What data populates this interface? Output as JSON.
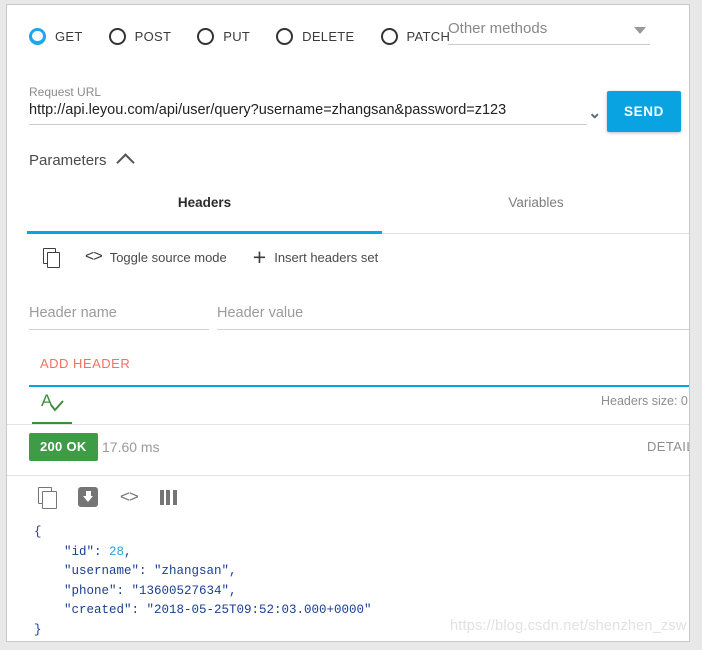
{
  "methods": {
    "options": [
      {
        "label": "GET",
        "selected": true
      },
      {
        "label": "POST",
        "selected": false
      },
      {
        "label": "PUT",
        "selected": false
      },
      {
        "label": "DELETE",
        "selected": false
      },
      {
        "label": "PATCH",
        "selected": false
      }
    ],
    "other_methods_label": "Other methods",
    "accent_color": "#1ca8e8"
  },
  "request": {
    "url_label": "Request URL",
    "url_value": "http://api.leyou.com/api/user/query?username=zhangsan&password=z123",
    "url_caret_icon": "chevron-down-icon",
    "send_label": "SEND",
    "send_color": "#08a3e0"
  },
  "parameters": {
    "title": "Parameters",
    "collapse_icon": "chevron-up-icon",
    "tabs": [
      {
        "label": "Headers",
        "active": true
      },
      {
        "label": "Variables",
        "active": false
      }
    ],
    "tab_underline_color": "#06a5de"
  },
  "headers_toolbar": {
    "copy_icon": "copy-icon",
    "source_icon": "code-brackets-icon",
    "source_label": "Toggle source mode",
    "add_icon": "plus-icon",
    "add_label": "Insert headers set"
  },
  "headers_form": {
    "name_placeholder": "Header name",
    "name_value": "",
    "value_placeholder": "Header value",
    "value_value": "",
    "add_header_label": "ADD HEADER",
    "add_header_color": "#f4705f",
    "spellcheck_icon": "spellcheck-icon",
    "headers_size_label": "Headers size: 0 "
  },
  "response": {
    "status_code": "200 OK",
    "status_color": "#3f9c46",
    "duration": "17.60 ms",
    "details_label": "DETAIL",
    "toolbar": {
      "copy_icon": "copy-icon",
      "save_icon": "save-download-icon",
      "source_icon": "code-brackets-icon",
      "columns_icon": "columns-icon"
    },
    "body_lines": [
      "{",
      "    \"id\": 28,",
      "    \"username\": \"zhangsan\",",
      "    \"phone\": \"13600527634\",",
      "    \"created\": \"2018-05-25T09:52:03.000+0000\"",
      "}"
    ],
    "body_json": {
      "id": 28,
      "username": "zhangsan",
      "phone": "13600527634",
      "created": "2018-05-25T09:52:03.000+0000"
    }
  },
  "watermark": "https://blog.csdn.net/shenzhen_zsw"
}
